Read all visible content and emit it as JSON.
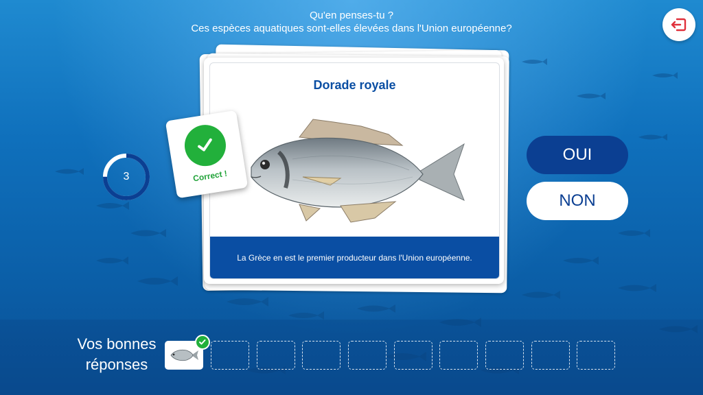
{
  "header": {
    "question_line1": "Qu'en penses-tu ?",
    "question_line2": "Ces espèces aquatiques sont-elles élevées dans l'Union européenne?",
    "exit_icon": "exit-icon"
  },
  "timer": {
    "value": "3",
    "progress": 0.75
  },
  "card": {
    "title": "Dorade royale",
    "image_icon": "sea-bream-fish-illustration",
    "footer": "La Grèce en est le premier producteur dans l'Union européenne."
  },
  "feedback": {
    "label": "Correct !",
    "icon": "checkmark-icon"
  },
  "answers": {
    "yes_label": "OUI",
    "no_label": "NON"
  },
  "results": {
    "label_line1": "Vos bonnes",
    "label_line2": "réponses",
    "filled_count": 1,
    "total_slots": 10
  },
  "colors": {
    "accent_blue": "#0a4ea3",
    "button_dark": "#0b3f92",
    "success_green": "#22b03b",
    "exit_red": "#e0303b"
  }
}
